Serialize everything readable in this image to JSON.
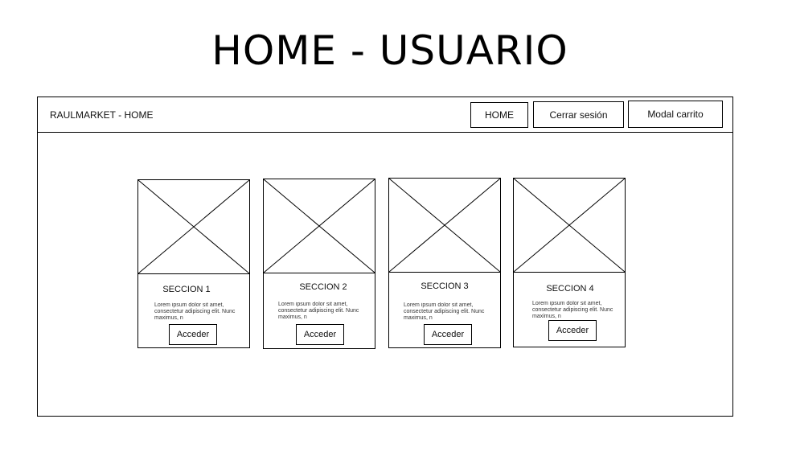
{
  "page": {
    "title": "HOME - USUARIO"
  },
  "navbar": {
    "brand": "RAULMARKET - HOME",
    "buttons": [
      "HOME",
      "Cerrar sesión",
      "Modal carrito"
    ]
  },
  "cards": [
    {
      "title": "SECCION 1",
      "text": "Lorem ipsum dolor sit amet, consectetur adipiscing elit. Nunc maximus, n",
      "button": "Acceder"
    },
    {
      "title": "SECCION 2",
      "text": "Lorem ipsum dolor sit amet, consectetur adipiscing elit. Nunc maximus, n",
      "button": "Acceder"
    },
    {
      "title": "SECCION 3",
      "text": "Lorem ipsum dolor sit amet, consectetur adipiscing elit. Nunc maximus, n",
      "button": "Acceder"
    },
    {
      "title": "SECCION 4",
      "text": "Lorem ipsum dolor sit amet, consectetur adipiscing elit. Nunc maximus, n",
      "button": "Acceder"
    }
  ]
}
